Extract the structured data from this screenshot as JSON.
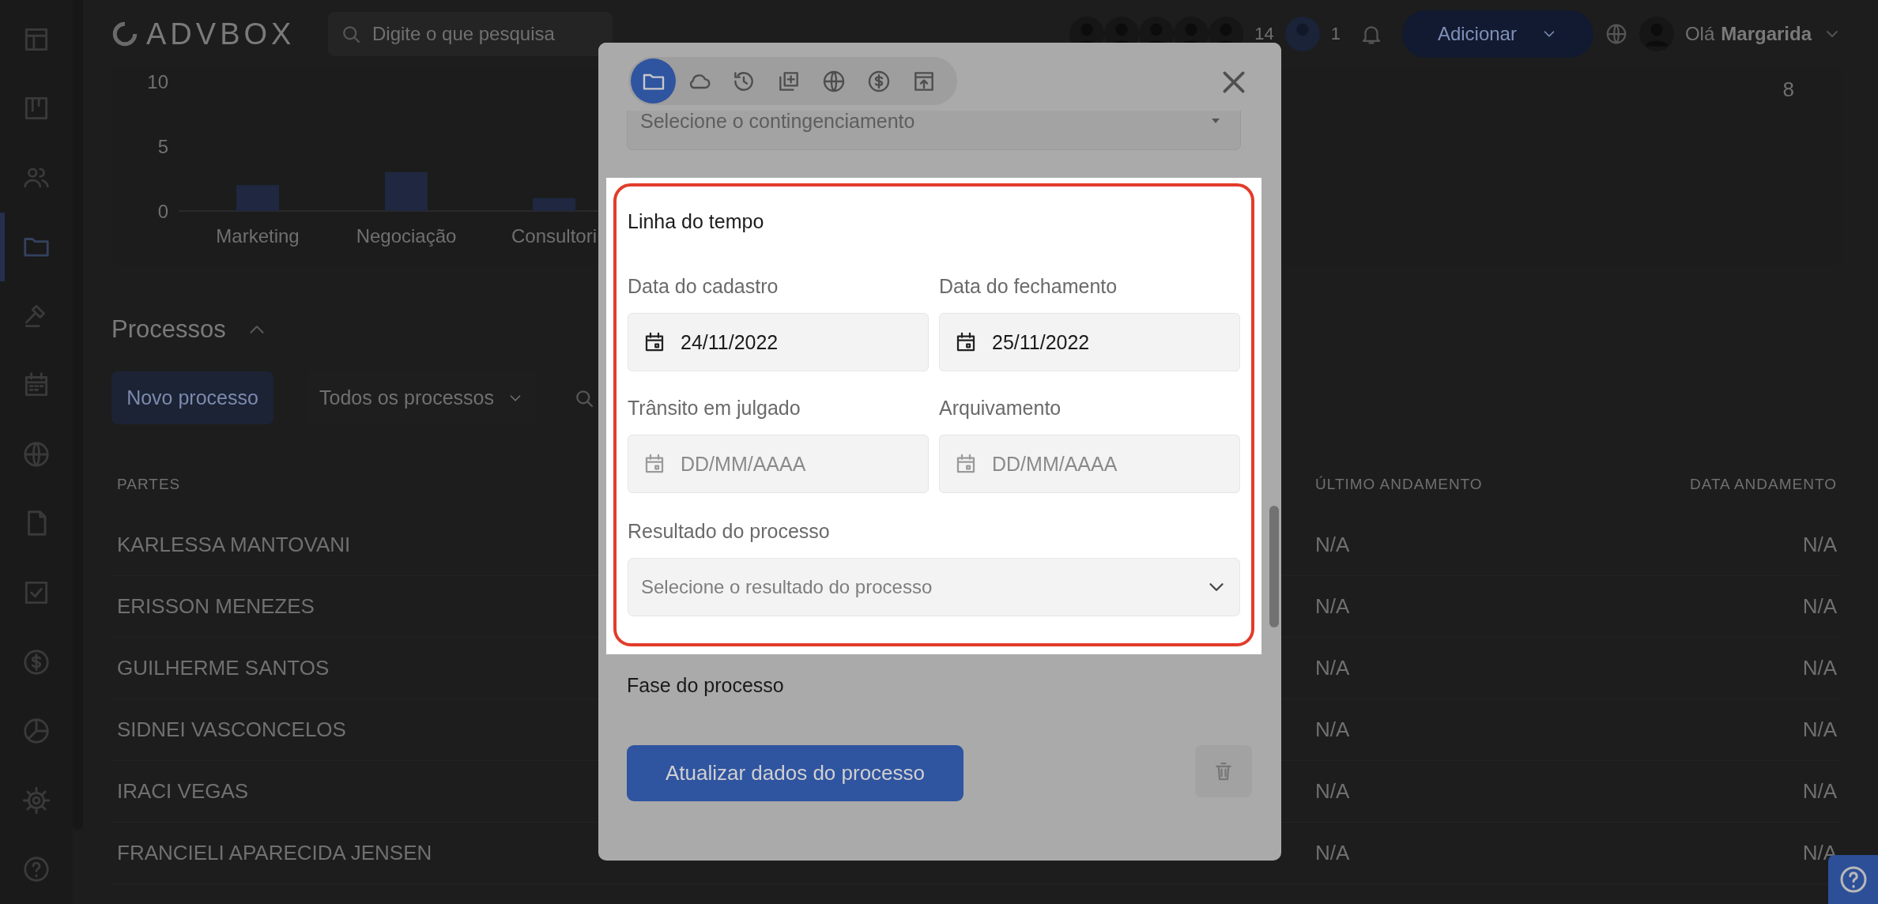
{
  "header": {
    "logo": "ADVBOX",
    "search": {
      "placeholder": "Digite o que pesquisa"
    },
    "member_count": "14",
    "notification_count": "1",
    "add_button": "Adicionar",
    "greeting": "Olá",
    "user_name": "Margarida"
  },
  "sidebar": {
    "items": [
      {
        "kind": "grid",
        "selected": false
      },
      {
        "kind": "board",
        "selected": false
      },
      {
        "kind": "people",
        "selected": false
      },
      {
        "kind": "folder",
        "selected": true
      },
      {
        "kind": "gavel",
        "selected": false
      },
      {
        "kind": "calendar",
        "selected": false
      },
      {
        "kind": "globe",
        "selected": false
      },
      {
        "kind": "document",
        "selected": false
      },
      {
        "kind": "checkbox",
        "selected": false
      },
      {
        "kind": "dollar",
        "selected": false
      },
      {
        "kind": "pie-chart",
        "selected": false
      },
      {
        "kind": "gear",
        "selected": false
      },
      {
        "kind": "help",
        "selected": false
      }
    ]
  },
  "chart": {
    "chart_data": {
      "type": "bar",
      "categories": [
        "Marketing",
        "Negociação",
        "Consultori"
      ],
      "values": [
        2,
        3,
        1
      ],
      "yticks": [
        0,
        5,
        10
      ],
      "ylim": [
        0,
        10
      ]
    },
    "page_count": "8"
  },
  "processes": {
    "title": "Processos",
    "expanded": true,
    "new_button": "Novo processo",
    "filter": "Todos os processos",
    "table": {
      "columns": [
        "PARTES",
        "ÚLTIMO ANDAMENTO",
        "DATA ANDAMENTO"
      ],
      "rows": [
        {
          "parties": "KARLESSA MANTOVANI",
          "last_update": "N/A",
          "update_date": "N/A"
        },
        {
          "parties": "ERISSON MENEZES",
          "last_update": "N/A",
          "update_date": "N/A"
        },
        {
          "parties": "GUILHERME SANTOS",
          "last_update": "N/A",
          "update_date": "N/A"
        },
        {
          "parties": "SIDNEI VASCONCELOS",
          "last_update": "N/A",
          "update_date": "N/A"
        },
        {
          "parties": "IRACI VEGAS",
          "last_update": "N/A",
          "update_date": "N/A"
        },
        {
          "parties": "FRANCIELI APARECIDA JENSEN",
          "last_update": "N/A",
          "update_date": "N/A"
        }
      ]
    }
  },
  "modal": {
    "tabs": [
      {
        "kind": "folder",
        "selected": true
      },
      {
        "kind": "cloud",
        "selected": false
      },
      {
        "kind": "history",
        "selected": false
      },
      {
        "kind": "stacked-plus",
        "selected": false
      },
      {
        "kind": "globe",
        "selected": false
      },
      {
        "kind": "dollar",
        "selected": false
      },
      {
        "kind": "upload",
        "selected": false
      }
    ],
    "contingency_select": {
      "placeholder": "Selecione o contingenciamento"
    },
    "timeline": {
      "title": "Linha do tempo",
      "highlighted": true,
      "fields": [
        {
          "label": "Data do cadastro",
          "value": "24/11/2022"
        },
        {
          "label": "Data do fechamento",
          "value": "25/11/2022"
        },
        {
          "label": "Trânsito em julgado",
          "placeholder": "DD/MM/AAAA"
        },
        {
          "label": "Arquivamento",
          "placeholder": "DD/MM/AAAA"
        }
      ],
      "result_select": {
        "label": "Resultado do processo",
        "placeholder": "Selecione o resultado do processo"
      }
    },
    "phase_title": "Fase do processo",
    "submit_button": "Atualizar dados do processo"
  }
}
